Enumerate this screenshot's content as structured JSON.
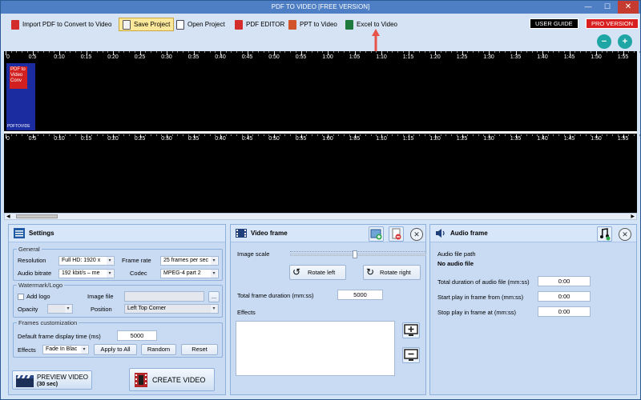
{
  "window": {
    "title": "PDF TO VIDEO [FREE VERSION]"
  },
  "toolbar": {
    "import_label": "Import PDF to Convert to Video",
    "save_label": "Save Project",
    "open_label": "Open Project",
    "pdf_editor_label": "PDF EDITOR",
    "ppt_label": "PPT to Video",
    "excel_label": "Excel to Video",
    "user_guide_label": "USER GUIDE",
    "pro_label": "PRO VERSION"
  },
  "timeline": {
    "ticks": [
      "0:5",
      "0:10",
      "0:15",
      "0:20",
      "0:25",
      "0:30",
      "0:35",
      "0:40",
      "0:45",
      "0:50",
      "0:55",
      "1:00",
      "1:05",
      "1:10",
      "1:15",
      "1:20",
      "1:25",
      "1:30",
      "1:35",
      "1:40",
      "1:45",
      "1:50",
      "1:55"
    ],
    "top_first_label": "0",
    "bottom_first_label": "0",
    "thumb_text": "PDF to Video Conv",
    "thumb_caption": "PDFTOVIDE"
  },
  "settings": {
    "title": "Settings",
    "general_label": "General",
    "resolution_label": "Resolution",
    "resolution_value": "Full HD: 1920 x",
    "frame_rate_label": "Frame rate",
    "frame_rate_value": "25 frames per sec",
    "audio_bitrate_label": "Audio bitrate",
    "audio_bitrate_value": "192 kbit/s – me",
    "codec_label": "Codec",
    "codec_value": "MPEG-4 part 2",
    "watermark_label": "Watermark/Logo",
    "add_logo_label": "Add logo",
    "image_file_label": "Image file",
    "browse_label": "...",
    "opacity_label": "Opacity",
    "position_label": "Position",
    "position_value": "Left Top Corner",
    "frames_label": "Frames customization",
    "default_time_label": "Default frame display time (ms)",
    "default_time_value": "5000",
    "effects_label": "Effects",
    "effects_value": "Fade In Blac",
    "apply_all_label": "Apply to All",
    "random_label": "Random",
    "reset_label": "Reset",
    "preview_label": "PREVIEW VIDEO",
    "preview_sub": "(30 sec)",
    "create_label": "CREATE VIDEO"
  },
  "video_frame": {
    "title": "Video frame",
    "image_scale_label": "Image scale",
    "rotate_left_label": "Rotate left",
    "rotate_right_label": "Rotate right",
    "duration_label": "Total frame duration (mm:ss)",
    "duration_value": "5000",
    "effects_label": "Effects"
  },
  "audio_frame": {
    "title": "Audio frame",
    "path_label": "Audio file path",
    "no_audio": "No audio file",
    "total_duration_label": "Total duration of audio file (mm:ss)",
    "total_duration_value": "0:00",
    "start_label": "Start play in frame from (mm:ss)",
    "start_value": "0:00",
    "stop_label": "Stop play in frame at (mm:ss)",
    "stop_value": "0:00"
  },
  "colors": {
    "accent": "#4e7ec4",
    "panel": "#c9dbf3",
    "close": "#c63b30",
    "pro": "#d81e1e",
    "arrow": "#e8544a"
  }
}
